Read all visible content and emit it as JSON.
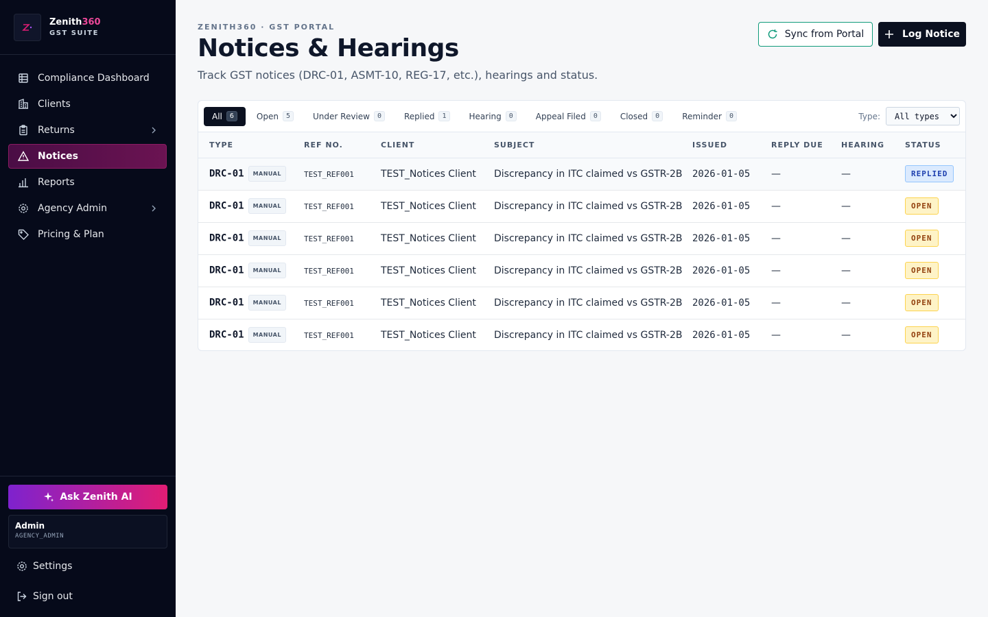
{
  "brand": {
    "name": "Zenith",
    "name_accent": "360",
    "sub": "GST SUITE"
  },
  "nav": [
    {
      "label": "Compliance Dashboard",
      "icon": "grid-icon"
    },
    {
      "label": "Clients",
      "icon": "building-icon"
    },
    {
      "label": "Returns",
      "icon": "clipboard-icon",
      "chevron": true
    },
    {
      "label": "Notices",
      "icon": "warning-triangle-icon",
      "active": true
    },
    {
      "label": "Reports",
      "icon": "bar-chart-icon"
    },
    {
      "label": "Agency Admin",
      "icon": "gear-icon",
      "chevron": true
    },
    {
      "label": "Pricing & Plan",
      "icon": "tag-icon"
    }
  ],
  "ai_button": "Ask Zenith AI",
  "user": {
    "name": "Admin",
    "role": "AGENCY_ADMIN"
  },
  "settings_label": "Settings",
  "signout_label": "Sign out",
  "header": {
    "eyebrow": "ZENITH360 · GST PORTAL",
    "title": "Notices & Hearings",
    "subtitle": "Track GST notices (DRC-01, ASMT-10, REG-17, etc.), hearings and status.",
    "sync_label": "Sync from Portal",
    "log_label": "Log Notice"
  },
  "tabs": [
    {
      "label": "All",
      "count": "6",
      "active": true
    },
    {
      "label": "Open",
      "count": "5"
    },
    {
      "label": "Under Review",
      "count": "0"
    },
    {
      "label": "Replied",
      "count": "1"
    },
    {
      "label": "Hearing",
      "count": "0"
    },
    {
      "label": "Appeal Filed",
      "count": "0"
    },
    {
      "label": "Closed",
      "count": "0"
    },
    {
      "label": "Reminder",
      "count": "0"
    }
  ],
  "type_filter": {
    "label": "Type:",
    "selected": "All types"
  },
  "columns": [
    "TYPE",
    "REF NO.",
    "CLIENT",
    "SUBJECT",
    "ISSUED",
    "REPLY DUE",
    "HEARING",
    "STATUS"
  ],
  "rows": [
    {
      "type": "DRC-01",
      "source": "MANUAL",
      "ref": "TEST_REF001",
      "client": "TEST_Notices Client",
      "subject": "Discrepancy in ITC claimed vs GSTR-2B",
      "issued": "2026-01-05",
      "reply_due": "—",
      "hearing": "—",
      "status": "REPLIED",
      "status_kind": "replied"
    },
    {
      "type": "DRC-01",
      "source": "MANUAL",
      "ref": "TEST_REF001",
      "client": "TEST_Notices Client",
      "subject": "Discrepancy in ITC claimed vs GSTR-2B",
      "issued": "2026-01-05",
      "reply_due": "—",
      "hearing": "—",
      "status": "OPEN",
      "status_kind": "open"
    },
    {
      "type": "DRC-01",
      "source": "MANUAL",
      "ref": "TEST_REF001",
      "client": "TEST_Notices Client",
      "subject": "Discrepancy in ITC claimed vs GSTR-2B",
      "issued": "2026-01-05",
      "reply_due": "—",
      "hearing": "—",
      "status": "OPEN",
      "status_kind": "open"
    },
    {
      "type": "DRC-01",
      "source": "MANUAL",
      "ref": "TEST_REF001",
      "client": "TEST_Notices Client",
      "subject": "Discrepancy in ITC claimed vs GSTR-2B",
      "issued": "2026-01-05",
      "reply_due": "—",
      "hearing": "—",
      "status": "OPEN",
      "status_kind": "open"
    },
    {
      "type": "DRC-01",
      "source": "MANUAL",
      "ref": "TEST_REF001",
      "client": "TEST_Notices Client",
      "subject": "Discrepancy in ITC claimed vs GSTR-2B",
      "issued": "2026-01-05",
      "reply_due": "—",
      "hearing": "—",
      "status": "OPEN",
      "status_kind": "open"
    },
    {
      "type": "DRC-01",
      "source": "MANUAL",
      "ref": "TEST_REF001",
      "client": "TEST_Notices Client",
      "subject": "Discrepancy in ITC claimed vs GSTR-2B",
      "issued": "2026-01-05",
      "reply_due": "—",
      "hearing": "—",
      "status": "OPEN",
      "status_kind": "open"
    }
  ],
  "colors": {
    "sidebar_bg": "#060a1a",
    "active_nav": "#6b1352",
    "accent_pink": "#ec4899",
    "sync_border": "#0f9a7a",
    "primary_dark": "#0b1120"
  }
}
